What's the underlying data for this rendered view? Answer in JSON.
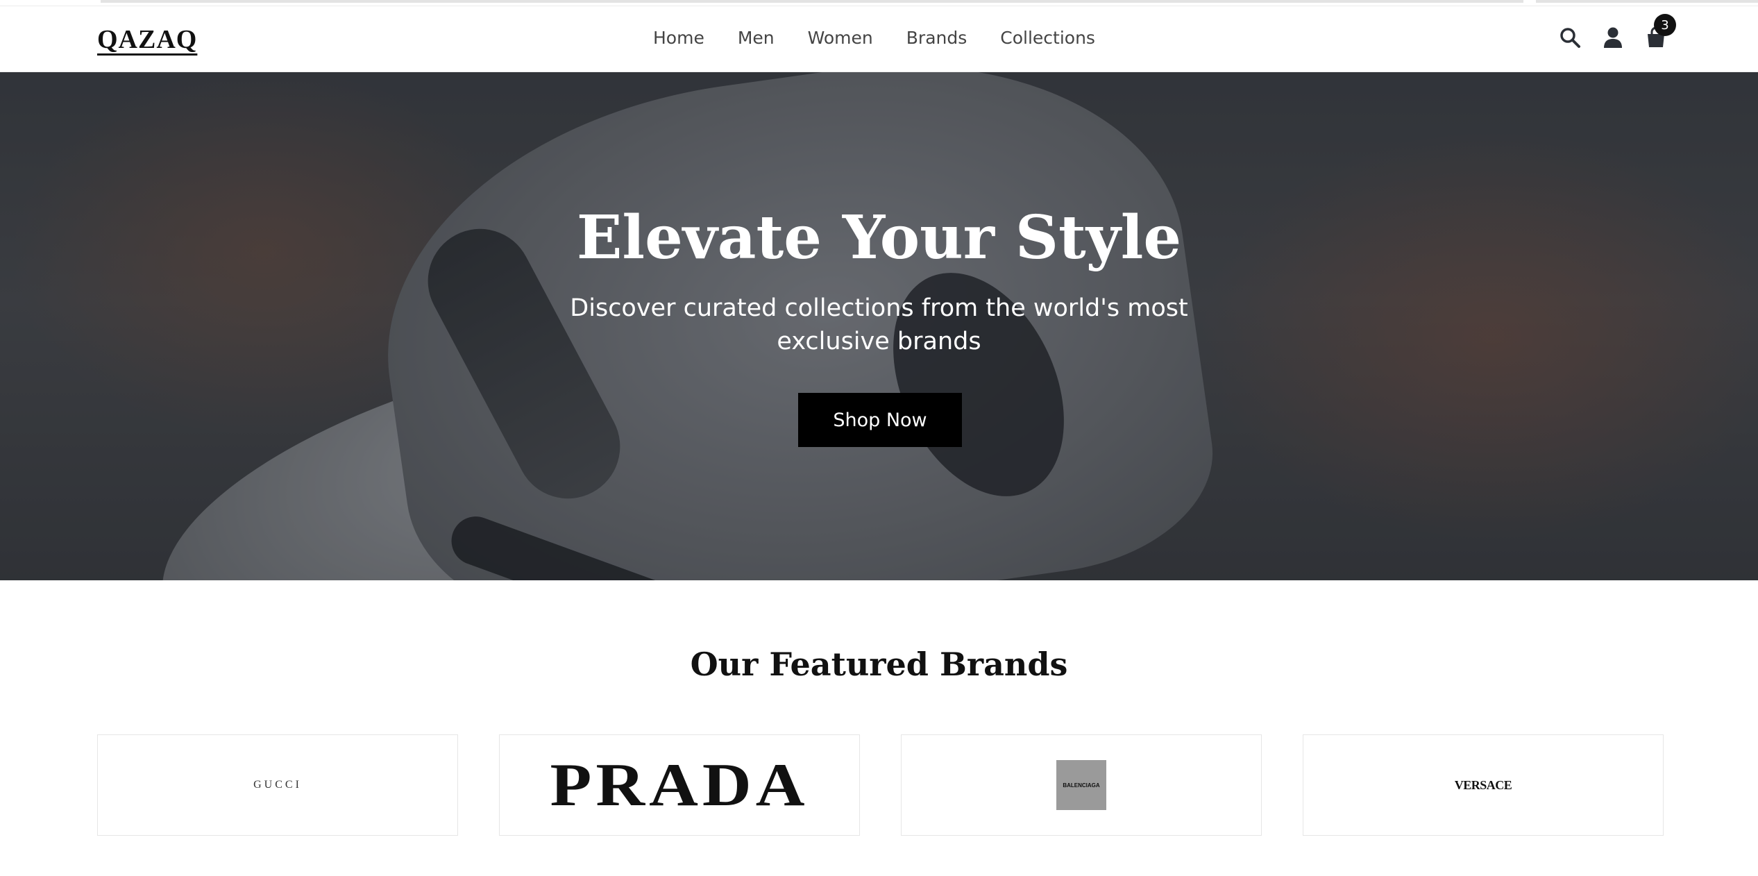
{
  "header": {
    "logo": "QAZAQ",
    "nav": [
      "Home",
      "Men",
      "Women",
      "Brands",
      "Collections"
    ],
    "cart_count": "3"
  },
  "hero": {
    "title": "Elevate Your Style",
    "subtitle": "Discover curated collections from the world's most exclusive brands",
    "cta": "Shop Now"
  },
  "brands": {
    "title": "Our Featured Brands",
    "items": [
      "GUCCI",
      "PRADA",
      "BALENCIAGA",
      "VERSACE"
    ]
  },
  "icons": [
    "search-icon",
    "user-icon",
    "shopping-bag-icon"
  ]
}
